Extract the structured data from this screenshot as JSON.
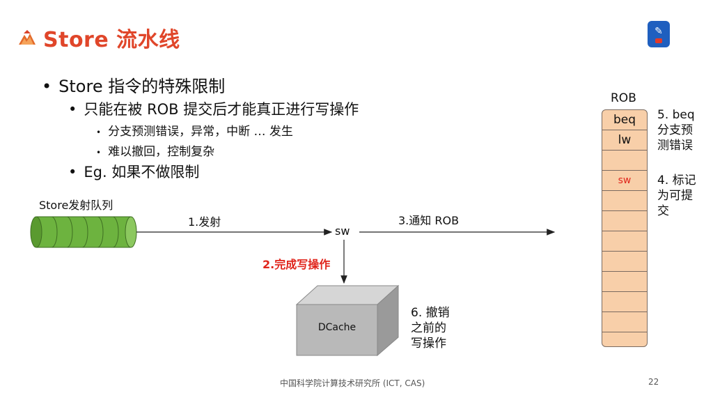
{
  "slide": {
    "title": "Store 流水线",
    "page_number": "22",
    "footer": "中国科学院计算技术研究所 (ICT, CAS)"
  },
  "bullets": {
    "b1": "Store 指令的特殊限制",
    "b1_1": "只能在被 ROB 提交后才能真正进行写操作",
    "b1_1_1": "分支预测错误，异常，中断 … 发生",
    "b1_1_2": "难以撤回，控制复杂",
    "b1_2": "Eg. 如果不做限制"
  },
  "diagram": {
    "queue_label": "Store发射队列",
    "issue_label": "1.发射",
    "sw_label": "sw",
    "notify_label": "3.通知 ROB",
    "write_label": "2.完成写操作",
    "dcache_label": "DCache",
    "undo_note": [
      "6. 撤销",
      "之前的",
      "写操作"
    ],
    "rob_title": "ROB",
    "rob_entries": [
      "beq",
      "lw",
      "",
      "sw",
      "",
      "",
      "",
      "",
      "",
      "",
      "",
      ""
    ],
    "rob_highlight_entry": "sw",
    "beq_note": [
      "5. beq",
      "分支预",
      "测错误"
    ],
    "mark_note": [
      "4. 标记",
      "为可提",
      "交"
    ]
  },
  "colors": {
    "title": "#e0462a",
    "highlight_red": "#e0241b",
    "rob_fill": "#f8cfa9",
    "queue_green": "#6db33f",
    "dcache_gray": "#b9b9b9"
  },
  "icons": {
    "title_logo": "mountain-logo-icon",
    "corner": "edit-badge-icon"
  }
}
